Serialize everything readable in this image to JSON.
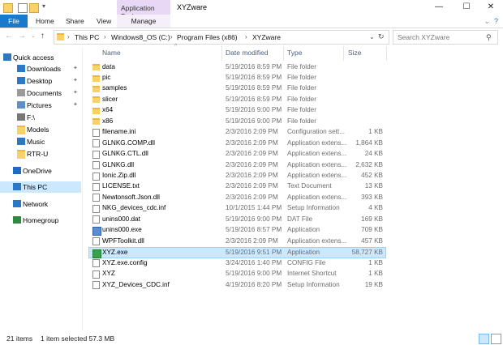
{
  "window": {
    "title": "XYZware",
    "contextual_tab_group": "Application Tools",
    "controls": {
      "minimize": "—",
      "maximize": "☐",
      "close": "✕"
    }
  },
  "ribbon": {
    "tabs": [
      "File",
      "Home",
      "Share",
      "View",
      "Manage"
    ],
    "help": "?"
  },
  "address": {
    "crumbs": [
      "This PC",
      "Windows8_OS (C:)",
      "Program Files (x86)",
      "XYZware"
    ],
    "search_placeholder": "Search XYZware"
  },
  "columns": {
    "name": "Name",
    "date": "Date modified",
    "type": "Type",
    "size": "Size"
  },
  "sidebar": {
    "items": [
      {
        "label": "Quick access",
        "icon": "star-icon"
      },
      {
        "label": "Downloads",
        "icon": "download-icon",
        "pinned": true
      },
      {
        "label": "Desktop",
        "icon": "desktop-icon",
        "pinned": true
      },
      {
        "label": "Documents",
        "icon": "documents-icon",
        "pinned": true
      },
      {
        "label": "Pictures",
        "icon": "pictures-icon",
        "pinned": true
      },
      {
        "label": "F:\\",
        "icon": "drive-icon"
      },
      {
        "label": "Models",
        "icon": "folder-icon"
      },
      {
        "label": "Music",
        "icon": "music-icon"
      },
      {
        "label": "RTR-U",
        "icon": "folder-icon"
      },
      {
        "label": "OneDrive",
        "icon": "cloud-icon"
      },
      {
        "label": "This PC",
        "icon": "computer-icon",
        "selected": true
      },
      {
        "label": "Network",
        "icon": "network-icon"
      },
      {
        "label": "Homegroup",
        "icon": "homegroup-icon"
      }
    ]
  },
  "files": [
    {
      "name": "data",
      "date": "5/19/2016 8:59 PM",
      "type": "File folder",
      "size": "",
      "icon": "folder"
    },
    {
      "name": "pic",
      "date": "5/19/2016 8:59 PM",
      "type": "File folder",
      "size": "",
      "icon": "folder"
    },
    {
      "name": "samples",
      "date": "5/19/2016 8:59 PM",
      "type": "File folder",
      "size": "",
      "icon": "folder"
    },
    {
      "name": "slicer",
      "date": "5/19/2016 8:59 PM",
      "type": "File folder",
      "size": "",
      "icon": "folder"
    },
    {
      "name": "x64",
      "date": "5/19/2016 9:00 PM",
      "type": "File folder",
      "size": "",
      "icon": "folder"
    },
    {
      "name": "x86",
      "date": "5/19/2016 9:00 PM",
      "type": "File folder",
      "size": "",
      "icon": "folder"
    },
    {
      "name": "filename.ini",
      "date": "2/3/2016 2:09 PM",
      "type": "Configuration sett...",
      "size": "1 KB",
      "icon": "doc"
    },
    {
      "name": "GLNKG.COMP.dll",
      "date": "2/3/2016 2:09 PM",
      "type": "Application extens...",
      "size": "1,864 KB",
      "icon": "doc"
    },
    {
      "name": "GLNKG.CTL.dll",
      "date": "2/3/2016 2:09 PM",
      "type": "Application extens...",
      "size": "24 KB",
      "icon": "doc"
    },
    {
      "name": "GLNKG.dll",
      "date": "2/3/2016 2:09 PM",
      "type": "Application extens...",
      "size": "2,632 KB",
      "icon": "doc"
    },
    {
      "name": "Ionic.Zip.dll",
      "date": "2/3/2016 2:09 PM",
      "type": "Application extens...",
      "size": "452 KB",
      "icon": "doc"
    },
    {
      "name": "LICENSE.txt",
      "date": "2/3/2016 2:09 PM",
      "type": "Text Document",
      "size": "13 KB",
      "icon": "doc"
    },
    {
      "name": "Newtonsoft.Json.dll",
      "date": "2/3/2016 2:09 PM",
      "type": "Application extens...",
      "size": "393 KB",
      "icon": "doc"
    },
    {
      "name": "NKG_devices_cdc.inf",
      "date": "10/1/2015 1:44 PM",
      "type": "Setup Information",
      "size": "4 KB",
      "icon": "doc"
    },
    {
      "name": "unins000.dat",
      "date": "5/19/2016 9:00 PM",
      "type": "DAT File",
      "size": "169 KB",
      "icon": "doc"
    },
    {
      "name": "unins000.exe",
      "date": "5/19/2016 8:57 PM",
      "type": "Application",
      "size": "709 KB",
      "icon": "app"
    },
    {
      "name": "WPFToolkit.dll",
      "date": "2/3/2016 2:09 PM",
      "type": "Application extens...",
      "size": "457 KB",
      "icon": "doc"
    },
    {
      "name": "XYZ.exe",
      "date": "5/19/2016 9:51 PM",
      "type": "Application",
      "size": "58,727 KB",
      "icon": "xyz",
      "selected": true
    },
    {
      "name": "XYZ.exe.config",
      "date": "3/24/2016 1:40 PM",
      "type": "CONFIG File",
      "size": "1 KB",
      "icon": "doc"
    },
    {
      "name": "XYZ",
      "date": "5/19/2016 9:00 PM",
      "type": "Internet Shortcut",
      "size": "1 KB",
      "icon": "doc"
    },
    {
      "name": "XYZ_Devices_CDC.inf",
      "date": "4/19/2016 8:20 PM",
      "type": "Setup Information",
      "size": "19 KB",
      "icon": "doc"
    }
  ],
  "status": {
    "count": "21 items",
    "selection": "1 item selected  57.3 MB"
  },
  "colors": {
    "accent": "#1979ca",
    "selection": "#cce8ff",
    "folder": "#f7d26a"
  }
}
